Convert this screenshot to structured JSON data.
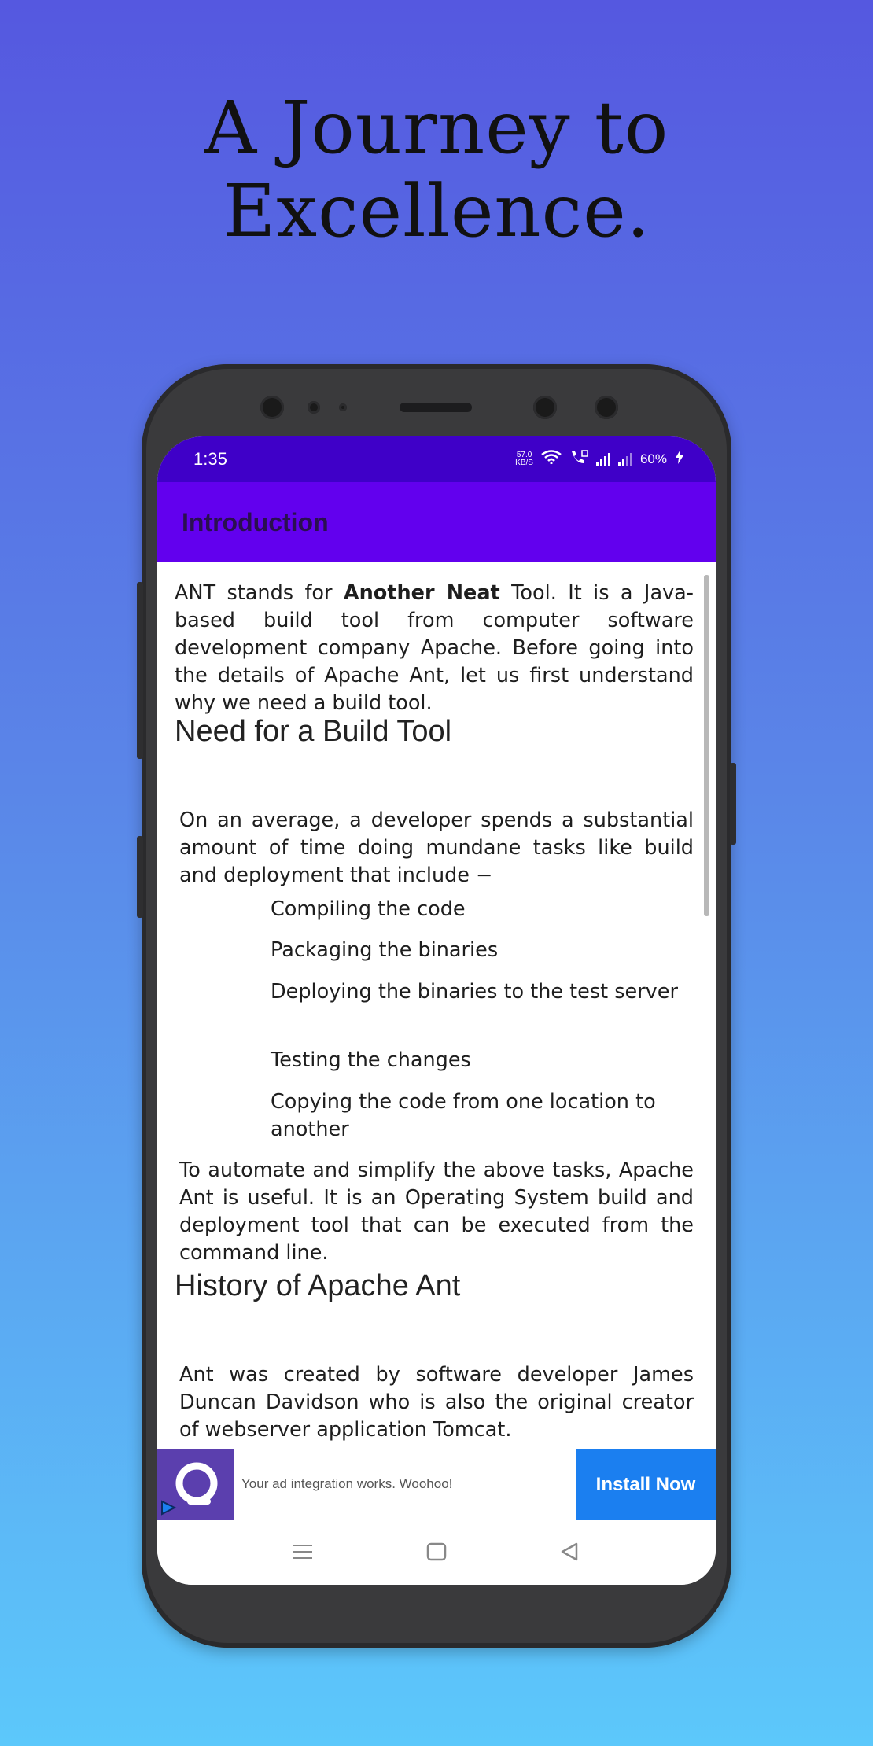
{
  "headline": {
    "line1": "A Journey to",
    "line2": "Excellence."
  },
  "status_bar": {
    "time": "1:35",
    "net_speed_value": "57.0",
    "net_speed_unit": "KB/S",
    "battery": "60%",
    "icons": [
      "wifi-icon",
      "volte-call-icon",
      "signal-icon",
      "signal-icon",
      "charging-icon"
    ]
  },
  "app_bar": {
    "title": "Introduction"
  },
  "content": {
    "intro": {
      "pre": " ANT stands for ",
      "bold": "Another Neat",
      "post": " Tool. It is a Java-based build tool from computer software development company Apache. Before going into the details of Apache Ant, let us first understand why we need a build tool."
    },
    "section1_heading": "Need for a Build Tool",
    "section1_para": "On an average, a developer spends a substantial amount of time doing mundane tasks like build and deployment that include −",
    "list_items": [
      "Compiling the code",
      "Packaging the binaries",
      "Deploying the binaries to the test server",
      "Testing the changes",
      "Copying the code from one location to another"
    ],
    "section1_para2": "To automate and simplify the above tasks, Apache Ant is useful. It is an Operating System build and deployment tool that can be executed from the command line.",
    "section2_heading": "History of Apache Ant",
    "section2_para": "Ant was created by software developer James Duncan Davidson who is also the original creator of webserver application Tomcat."
  },
  "ad": {
    "text": "Your ad integration works. Woohoo!",
    "button_label": "Install Now"
  },
  "nav": {
    "icons": [
      "recents-icon",
      "home-icon",
      "back-icon"
    ]
  },
  "colors": {
    "app_bar": "#6200ee",
    "status_bar": "#3f00c8",
    "ad_button": "#1b7ff0",
    "ad_logo_bg": "#5b3fae"
  }
}
